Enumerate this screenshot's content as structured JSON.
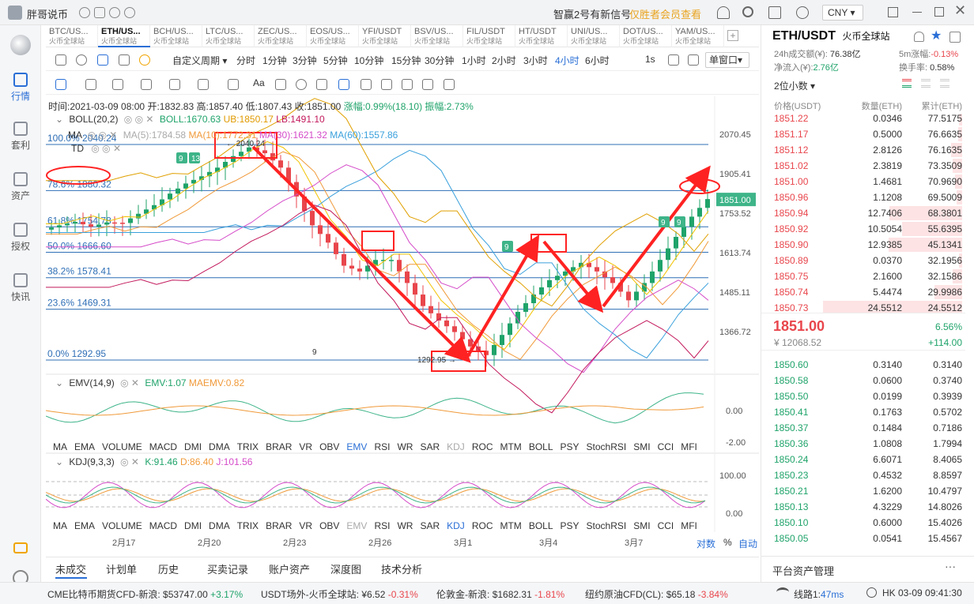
{
  "titlebar": {
    "app_name": "胖哥说币",
    "notice": "智赢2号有新信号",
    "vip_link": "仅胜者会员查看",
    "currency": "CNY"
  },
  "nav": [
    {
      "label": "行情",
      "icon": "market-icon"
    },
    {
      "label": "套利",
      "icon": "arbitrage-icon"
    },
    {
      "label": "资产",
      "icon": "asset-icon"
    },
    {
      "label": "授权",
      "icon": "authorize-icon"
    },
    {
      "label": "快讯",
      "icon": "news-icon"
    }
  ],
  "tabs": [
    {
      "pair": "BTC/US...",
      "exchange": "火币全球站"
    },
    {
      "pair": "ETH/US...",
      "exchange": "火币全球站"
    },
    {
      "pair": "BCH/US...",
      "exchange": "火币全球站"
    },
    {
      "pair": "LTC/US...",
      "exchange": "火币全球站"
    },
    {
      "pair": "ZEC/US...",
      "exchange": "火币全球站"
    },
    {
      "pair": "EOS/US...",
      "exchange": "火币全球站"
    },
    {
      "pair": "YFI/USDT",
      "exchange": "火币全球站"
    },
    {
      "pair": "BSV/US...",
      "exchange": "火币全球站"
    },
    {
      "pair": "FIL/USDT",
      "exchange": "火币全球站"
    },
    {
      "pair": "HT/USDT",
      "exchange": "火币全球站"
    },
    {
      "pair": "UNI/US...",
      "exchange": "火币全球站"
    },
    {
      "pair": "DOT/US...",
      "exchange": "火币全球站"
    },
    {
      "pair": "YAM/US...",
      "exchange": "火币全球站"
    }
  ],
  "periods": {
    "custom": "自定义周期",
    "items": [
      "分时",
      "1分钟",
      "3分钟",
      "5分钟",
      "10分钟",
      "15分钟",
      "30分钟",
      "1小时",
      "2小时",
      "3小时",
      "4小时",
      "6小时"
    ],
    "active": "4小时",
    "extra": "1s",
    "window": "单窗口"
  },
  "ohlc": {
    "time": "时间:2021-03-09 08:00",
    "open": "开:1832.83",
    "high": "高:1857.40",
    "low": "低:1807.43",
    "close": "收:1851.00",
    "change": "涨幅:0.99%(18.10)",
    "amplitude": "振幅:2.73%"
  },
  "boll": {
    "name": "BOLL(20,2)",
    "boll": "BOLL:1670.63",
    "ub": "UB:1850.17",
    "lb": "LB:1491.10"
  },
  "ma": {
    "name": "MA",
    "ma5": "MA(5):1784.58",
    "ma10": "MA(10):1772.31",
    "ma30": "MA(30):1621.32",
    "ma60": "MA(60):1557.86"
  },
  "td": "TD",
  "fib": [
    {
      "label": "100.0% 2040.24",
      "pct": 1.0
    },
    {
      "label": "78.6% 1880.32",
      "pct": 0.786
    },
    {
      "label": "61.8% 1754.78",
      "pct": 0.618
    },
    {
      "label": "50.0% 1666.60",
      "pct": 0.5
    },
    {
      "label": "38.2% 1578.41",
      "pct": 0.382
    },
    {
      "label": "23.6% 1469.31",
      "pct": 0.236
    },
    {
      "label": "0.0% 1292.95",
      "pct": 0.0
    }
  ],
  "price_axis": [
    "2070.45",
    "1905.41",
    "1753.52",
    "1613.74",
    "1485.11",
    "1366.72"
  ],
  "current_price_tag": "1851.00",
  "chart_annotations": {
    "high": "← 2040.24",
    "low": "1292.95 →",
    "td_counts": [
      "9",
      "13",
      "9",
      "9",
      "9"
    ],
    "td_low": "9"
  },
  "emv": {
    "name": "EMV(14,9)",
    "emv": "EMV:1.07",
    "maemv": "MAEMV:0.82",
    "axis": [
      "0.00",
      "-2.00"
    ]
  },
  "indicators": [
    "MA",
    "EMA",
    "VOLUME",
    "MACD",
    "DMI",
    "DMA",
    "TRIX",
    "BRAR",
    "VR",
    "OBV",
    "EMV",
    "RSI",
    "WR",
    "SAR",
    "KDJ",
    "ROC",
    "MTM",
    "BOLL",
    "PSY",
    "StochRSI",
    "SMI",
    "CCI",
    "MFI"
  ],
  "indicators_active_top": "EMV",
  "indicators_active_bottom": "KDJ",
  "kdj": {
    "name": "KDJ(9,3,3)",
    "k": "K:91.46",
    "d": "D:86.40",
    "j": "J:101.56",
    "axis": [
      "100.00",
      "0.00"
    ]
  },
  "dates": [
    "2月17",
    "2月20",
    "2月23",
    "2月26",
    "3月1",
    "3月4",
    "3月7"
  ],
  "axis_modes": {
    "log": "对数",
    "pct": "%",
    "auto": "自动"
  },
  "bottom_tabs": [
    "未成交",
    "计划单",
    "历史",
    "买卖记录",
    "账户资产",
    "深度图",
    "技术分析"
  ],
  "right": {
    "pair": "ETH/USDT",
    "exchange": "火币全球站",
    "vol_label": "24h成交额(¥):",
    "vol": "76.38亿",
    "change5_label": "5m涨幅:",
    "change5": "-0.13%",
    "inflow_label": "净流入(¥):",
    "inflow": "2.76亿",
    "turnover_label": "换手率:",
    "turnover": "0.58%",
    "decimals": "2位小数",
    "headers": {
      "price": "价格(USDT)",
      "qty": "数量(ETH)",
      "total": "累计(ETH)"
    },
    "asks": [
      {
        "p": "1851.22",
        "q": "0.0346",
        "t": "77.5175",
        "w": 0.02
      },
      {
        "p": "1851.17",
        "q": "0.5000",
        "t": "76.6635",
        "w": 0.03
      },
      {
        "p": "1851.12",
        "q": "2.8126",
        "t": "76.1635",
        "w": 0.08
      },
      {
        "p": "1851.02",
        "q": "2.3819",
        "t": "73.3509",
        "w": 0.07
      },
      {
        "p": "1851.00",
        "q": "1.4681",
        "t": "70.9690",
        "w": 0.05
      },
      {
        "p": "1850.96",
        "q": "1.1208",
        "t": "69.5009",
        "w": 0.04
      },
      {
        "p": "1850.94",
        "q": "12.7406",
        "t": "68.3801",
        "w": 0.52
      },
      {
        "p": "1850.92",
        "q": "10.5054",
        "t": "55.6395",
        "w": 0.43
      },
      {
        "p": "1850.90",
        "q": "12.9385",
        "t": "45.1341",
        "w": 0.53
      },
      {
        "p": "1850.89",
        "q": "0.0370",
        "t": "32.1956",
        "w": 0.02
      },
      {
        "p": "1850.75",
        "q": "2.1600",
        "t": "32.1586",
        "w": 0.07
      },
      {
        "p": "1850.74",
        "q": "5.4474",
        "t": "29.9986",
        "w": 0.2
      },
      {
        "p": "1850.73",
        "q": "24.5512",
        "t": "24.5512",
        "w": 1.0
      }
    ],
    "last_price": "1851.00",
    "last_cny": "¥ 12068.52",
    "last_change_pct": "6.56%",
    "last_change": "+114.00",
    "bids": [
      {
        "p": "1850.60",
        "q": "0.3140",
        "t": "0.3140"
      },
      {
        "p": "1850.58",
        "q": "0.0600",
        "t": "0.3740"
      },
      {
        "p": "1850.50",
        "q": "0.0199",
        "t": "0.3939"
      },
      {
        "p": "1850.41",
        "q": "0.1763",
        "t": "0.5702"
      },
      {
        "p": "1850.37",
        "q": "0.1484",
        "t": "0.7186"
      },
      {
        "p": "1850.36",
        "q": "1.0808",
        "t": "1.7994"
      },
      {
        "p": "1850.24",
        "q": "6.6071",
        "t": "8.4065"
      },
      {
        "p": "1850.23",
        "q": "0.4532",
        "t": "8.8597"
      },
      {
        "p": "1850.21",
        "q": "1.6200",
        "t": "10.4797"
      },
      {
        "p": "1850.13",
        "q": "4.3229",
        "t": "14.8026"
      },
      {
        "p": "1850.10",
        "q": "0.6000",
        "t": "15.4026"
      },
      {
        "p": "1850.05",
        "q": "0.0541",
        "t": "15.4567"
      }
    ],
    "platform": "平台资产管理"
  },
  "ticker": [
    {
      "name": "CME比特币期货CFD-新浪:",
      "price": "$53747.00",
      "chg": "+3.17%",
      "up": true
    },
    {
      "name": "USDT场外-火币全球站:",
      "price": "¥6.52",
      "chg": "-0.31%",
      "up": false
    },
    {
      "name": "伦敦金-新浪:",
      "price": "$1682.31",
      "chg": "-1.81%",
      "up": false
    },
    {
      "name": "纽约原油CFD(CL):",
      "price": "$65.18",
      "chg": "-3.84%",
      "up": false
    }
  ],
  "status": {
    "line": "线路1:",
    "latency": "47ms",
    "clock": "HK 03-09 09:41:30"
  },
  "colors": {
    "up": "#1fa36a",
    "down": "#e8464c",
    "accent": "#2a6fd6",
    "fib": "#2f6fb6",
    "arrow": "#ff2222",
    "ma5": "#f2c200",
    "ma10": "#f09a3a",
    "ma30": "#d54bc9",
    "ma60": "#3aa0dc"
  }
}
